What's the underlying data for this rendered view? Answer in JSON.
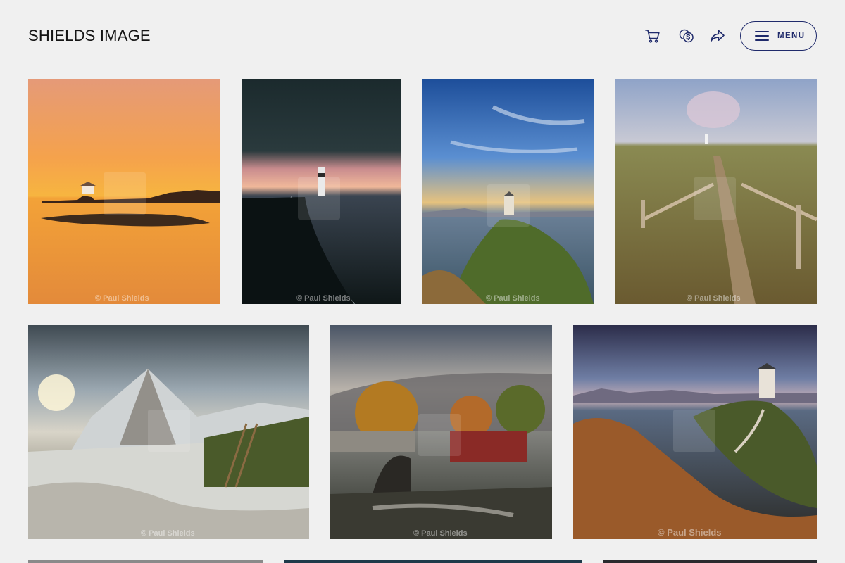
{
  "header": {
    "brand": "SHIELDS IMAGE",
    "icons": [
      "cart-icon",
      "currency-icon",
      "share-icon"
    ],
    "menu_label": "MENU",
    "accent_color": "#1f2a6b"
  },
  "gallery": {
    "tiles": [
      {
        "credit": "© Paul Shields"
      },
      {
        "credit": "© Paul Shields"
      },
      {
        "credit": "© Paul Shields"
      },
      {
        "credit": "© Paul Shields"
      },
      {
        "credit": "© Paul Shields"
      },
      {
        "credit": "© Paul Shields"
      },
      {
        "credit": "© Paul Shields"
      }
    ]
  }
}
